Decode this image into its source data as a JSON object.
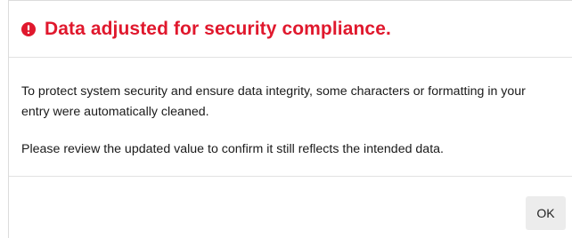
{
  "dialog": {
    "title": "Data adjusted for security compliance.",
    "icon": "alert-circle-icon",
    "accent_color": "#e0182d",
    "paragraphs": [
      "To protect system security and ensure data integrity, some characters or formatting in your entry were automatically cleaned.",
      "Please review the updated value to confirm it still reflects the intended data."
    ],
    "ok_label": "OK"
  }
}
